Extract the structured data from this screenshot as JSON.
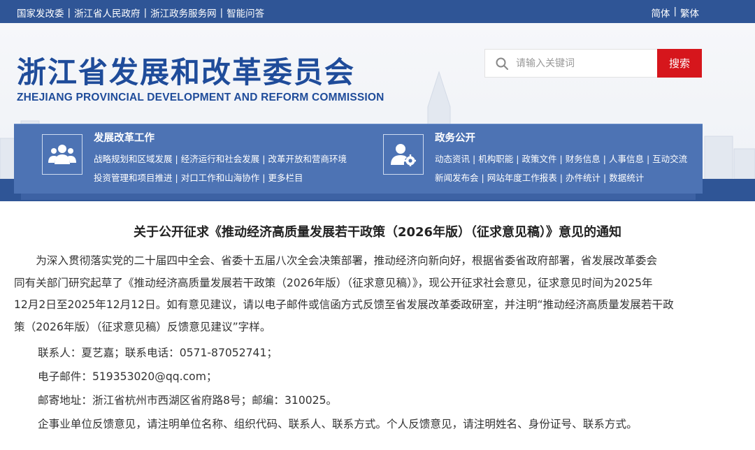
{
  "topbar": {
    "links": [
      "国家发改委",
      "浙江省人民政府",
      "浙江政务服务网",
      "智能问答"
    ],
    "lang": [
      "简体",
      "繁体"
    ]
  },
  "header": {
    "title_cn": "浙江省发展和改革委员会",
    "title_en": "ZHEJIANG PROVINCIAL DEVELOPMENT AND REFORM COMMISSION",
    "search_placeholder": "请输入关键词",
    "search_button": "搜索"
  },
  "nav": {
    "groups": [
      {
        "title": "发展改革工作",
        "icon": "people-group-icon",
        "rows": [
          [
            "战略规划和区域发展",
            "经济运行和社会发展",
            "改革开放和营商环境"
          ],
          [
            "投资管理和项目推进",
            "对口工作和山海协作",
            "更多栏目"
          ]
        ]
      },
      {
        "title": "政务公开",
        "icon": "user-gear-icon",
        "rows": [
          [
            "动态资讯",
            "机构职能",
            "政策文件",
            "财务信息",
            "人事信息",
            "互动交流"
          ],
          [
            "新闻发布会",
            "网站年度工作报表",
            "办件统计",
            "数据统计"
          ]
        ]
      }
    ]
  },
  "article": {
    "title": "关于公开征求《推动经济高质量发展若干政策（2026年版）（征求意见稿）》意见的通知",
    "para_lines": [
      "　　为深入贯彻落实党的二十届四中全会、省委十五届八次全会决策部署，推动经济向新向好，根据省委省政府部署，省发展改革委会",
      "同有关部门研究起草了《推动经济高质量发展若干政策（2026年版）（征求意见稿）》，现公开征求社会意见，征求意见时间为2025年",
      "12月2日至2025年12月12日。如有意见建议，请以电子邮件或信函方式反馈至省发展改革委政研室，并注明“推动经济高质量发展若干政",
      "策（2026年版）（征求意见稿）反馈意见建议”字样。"
    ],
    "contact": "联系人：夏艺嘉；联系电话：0571-87052741；",
    "email": "电子邮件：519353020@qq.com；",
    "address": "邮寄地址：浙江省杭州市西湖区省府路8号；邮编：310025。",
    "note": "企事业单位反馈意见，请注明单位名称、组织代码、联系人、联系方式。个人反馈意见，请注明姓名、身份证号、联系方式。"
  }
}
